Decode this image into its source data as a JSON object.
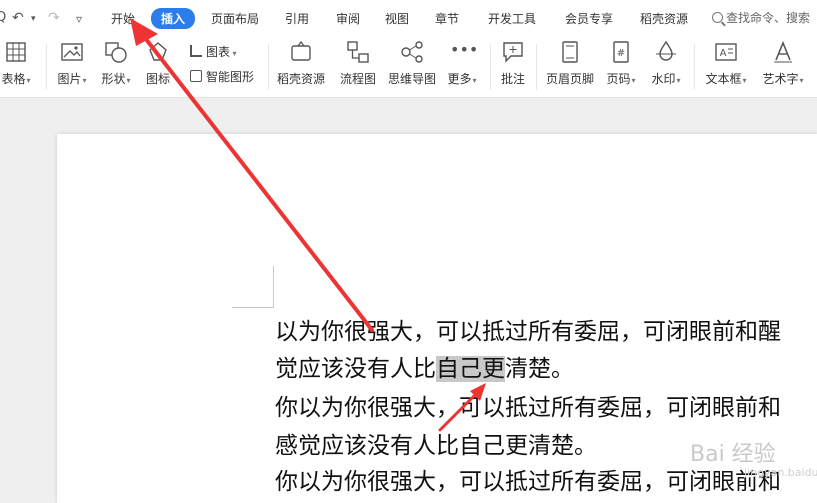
{
  "quick_access": {
    "redo_label": "↶",
    "undo_label": "↷",
    "more_label": "▿"
  },
  "menu": {
    "tabs": [
      {
        "label": "开始"
      },
      {
        "label": "插入"
      },
      {
        "label": "页面布局"
      },
      {
        "label": "引用"
      },
      {
        "label": "审阅"
      },
      {
        "label": "视图"
      },
      {
        "label": "章节"
      },
      {
        "label": "开发工具"
      },
      {
        "label": "会员专享"
      },
      {
        "label": "稻壳资源"
      }
    ],
    "search_placeholder": "查找命令、搜索"
  },
  "ribbon": {
    "table": "表格",
    "picture": "图片",
    "shape": "形状",
    "icons": "图标",
    "chart": "图表",
    "smart_graphic": "智能图形",
    "daoke": "稻壳资源",
    "flowchart": "流程图",
    "mindmap": "思维导图",
    "more": "更多",
    "comment": "批注",
    "header_footer": "页眉页脚",
    "page_number": "页码",
    "watermark": "水印",
    "textbox": "文本框",
    "wordart": "艺术字"
  },
  "document": {
    "line1": "以为你很强大，可以抵过所有委屈，可闭眼前和醒",
    "line2_pre": "觉应该没有人比",
    "line2_hl": "自己更",
    "line2_post": "清楚。",
    "line3": "你以为你很强大，可以抵过所有委屈，可闭眼前和",
    "line4": "感觉应该没有人比自己更清楚。",
    "line5": "你以为你很强大，可以抵过所有委屈，可闭眼前和"
  },
  "watermark": {
    "text": "Bai 经验",
    "sub": "jingyan.baidu.com"
  },
  "colors": {
    "accent": "#2b7de9",
    "arrow": "#ee3333"
  }
}
